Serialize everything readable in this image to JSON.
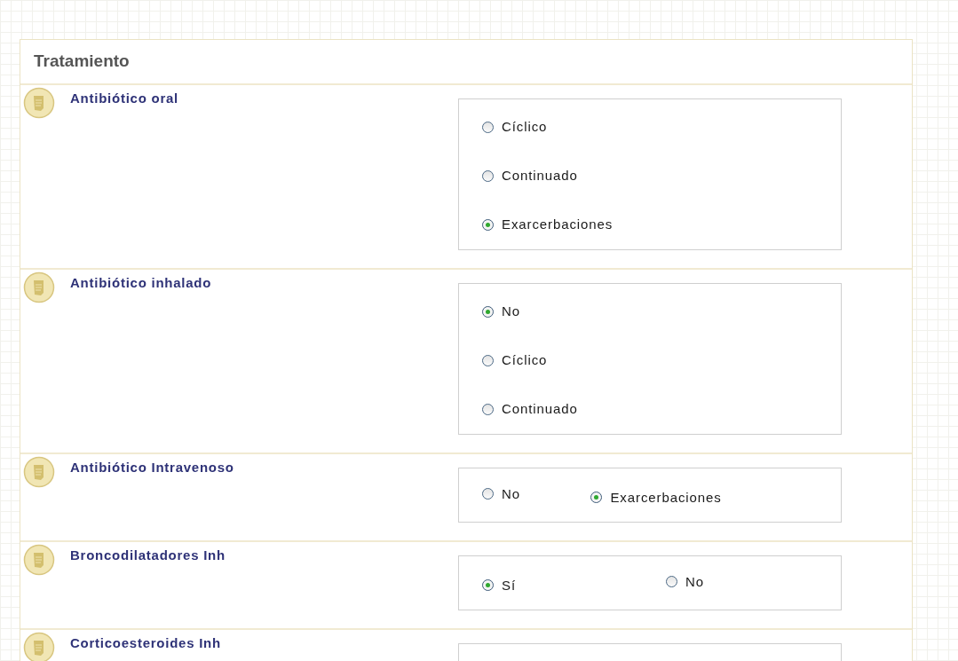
{
  "panel": {
    "title": "Tratamiento"
  },
  "questions": [
    {
      "label": "Antibiótico oral",
      "kind": "vertical",
      "options": [
        {
          "label": "Cíclico",
          "selected": false
        },
        {
          "label": "Continuado",
          "selected": false
        },
        {
          "label": "Exarcerbaciones",
          "selected": true
        }
      ]
    },
    {
      "label": "Antibiótico inhalado",
      "kind": "vertical",
      "options": [
        {
          "label": "No",
          "selected": true
        },
        {
          "label": "Cíclico",
          "selected": false
        },
        {
          "label": "Continuado",
          "selected": false
        }
      ]
    },
    {
      "label": "Antibiótico Intravenoso",
      "kind": "horizontal",
      "options": [
        {
          "label": "No",
          "selected": false
        },
        {
          "label": "Exarcerbaciones",
          "selected": true
        }
      ]
    },
    {
      "label": "Broncodilatadores Inh",
      "kind": "horizontal",
      "options": [
        {
          "label": "Sí",
          "selected": true
        },
        {
          "label": "No",
          "selected": false
        }
      ]
    },
    {
      "label": "Corticoesteroides Inh",
      "kind": "horizontal"
    }
  ]
}
